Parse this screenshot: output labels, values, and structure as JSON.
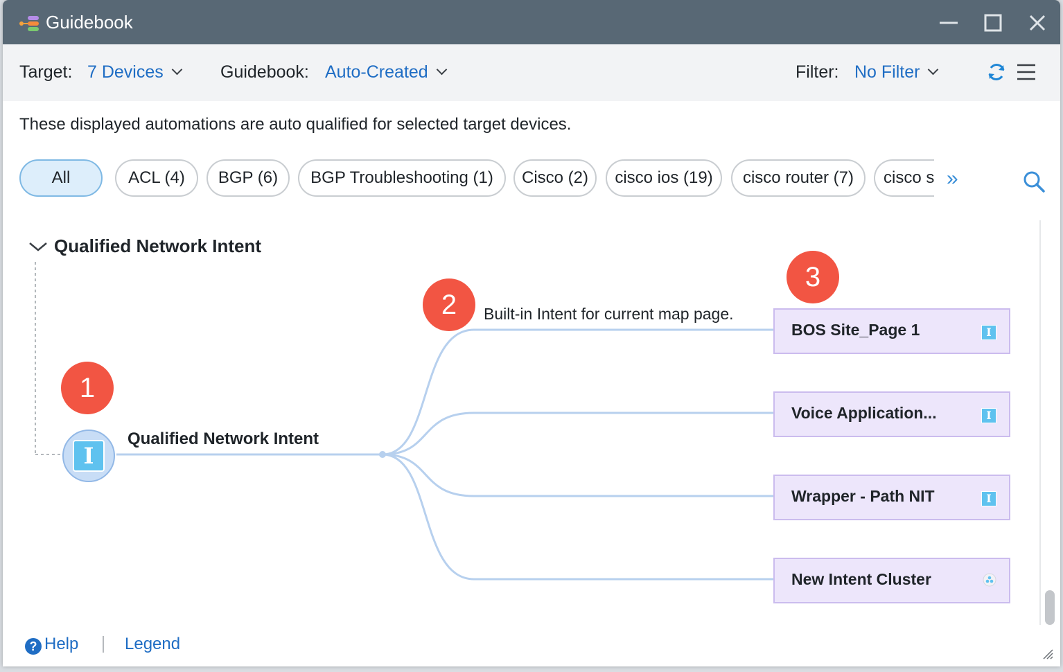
{
  "window": {
    "title": "Guidebook",
    "minimize_icon": "minimize-icon",
    "maximize_icon": "maximize-icon",
    "close_icon": "close-icon"
  },
  "toolbar": {
    "target_label": "Target:",
    "target_value": "7 Devices",
    "guidebook_label": "Guidebook:",
    "guidebook_value": "Auto-Created",
    "filter_label": "Filter:",
    "filter_value": "No Filter",
    "refresh_icon": "refresh-icon",
    "menu_icon": "hamburger-menu-icon"
  },
  "description": "These displayed automations are auto qualified for selected target devices.",
  "tags": [
    {
      "label": "All",
      "active": true
    },
    {
      "label": "ACL (4)",
      "active": false
    },
    {
      "label": "BGP (6)",
      "active": false
    },
    {
      "label": "BGP Troubleshooting (1)",
      "active": false
    },
    {
      "label": "Cisco (2)",
      "active": false
    },
    {
      "label": "cisco ios (19)",
      "active": false
    },
    {
      "label": "cisco router (7)",
      "active": false
    },
    {
      "label": "cisco s",
      "active": false
    }
  ],
  "tags_more_label": "»",
  "section": {
    "title": "Qualified Network Intent",
    "root_label": "Qualified Network Intent",
    "root_icon_glyph": "I",
    "branch_label": "Built-in Intent for current map page.",
    "nodes": [
      {
        "label": "BOS Site_Page 1",
        "icon": "intent-icon",
        "glyph": "I"
      },
      {
        "label": "Voice Application...",
        "icon": "intent-icon",
        "glyph": "I"
      },
      {
        "label": "Wrapper - Path NIT",
        "icon": "intent-icon",
        "glyph": "I"
      },
      {
        "label": "New Intent Cluster",
        "icon": "cluster-icon",
        "glyph": ""
      }
    ]
  },
  "badges": [
    "1",
    "2",
    "3"
  ],
  "footer": {
    "help_glyph": "?",
    "help_label": "Help",
    "legend_label": "Legend"
  },
  "colors": {
    "titlebar": "#586875",
    "accent_blue": "#1f6dc4",
    "badge_red": "#f25543",
    "node_fill": "#ede6fb",
    "edge": "#b7d0ee"
  }
}
